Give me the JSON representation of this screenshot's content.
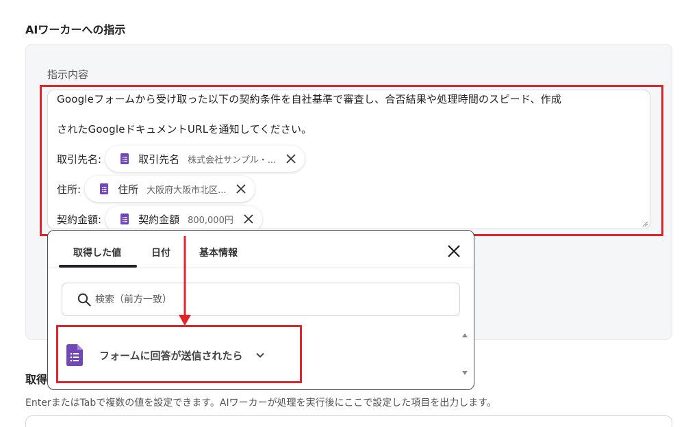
{
  "section": {
    "title": "AIワーカーへの指示"
  },
  "instruction": {
    "label": "指示内容",
    "line1": "Googleフォームから受け取った以下の契約条件を自社基準で審査し、合否結果や処理時間のスピード、作成",
    "line2": "されたGoogleドキュメントURLを通知してください。",
    "variables": [
      {
        "prefix": "取引先名:",
        "name": "取引先名",
        "value": "株式会社サンプル・..."
      },
      {
        "prefix": "住所:",
        "name": "住所",
        "value": "大阪府大阪市北区..."
      },
      {
        "prefix": "契約金額:",
        "name": "契約金額",
        "value": "800,000円"
      }
    ]
  },
  "popup": {
    "tabs": [
      {
        "label": "取得した値",
        "active": true
      },
      {
        "label": "日付",
        "active": false
      },
      {
        "label": "基本情報",
        "active": false
      }
    ],
    "search_placeholder": "検索（前方一致）",
    "list_item": "フォームに回答が送信されたら"
  },
  "output": {
    "title_partial": "取得",
    "hint": "EnterまたはTabで複数の値を設定できます。AIワーカーが処理を実行後にここで設定した項目を出力します。"
  },
  "colors": {
    "highlight": "#e0242a",
    "forms_purple": "#7248b9",
    "card_bg": "#f5f6f7"
  },
  "icons": [
    "doc-icon",
    "close-icon",
    "search-icon",
    "google-forms-icon",
    "chevron-down-icon",
    "resize-handle-icon"
  ]
}
